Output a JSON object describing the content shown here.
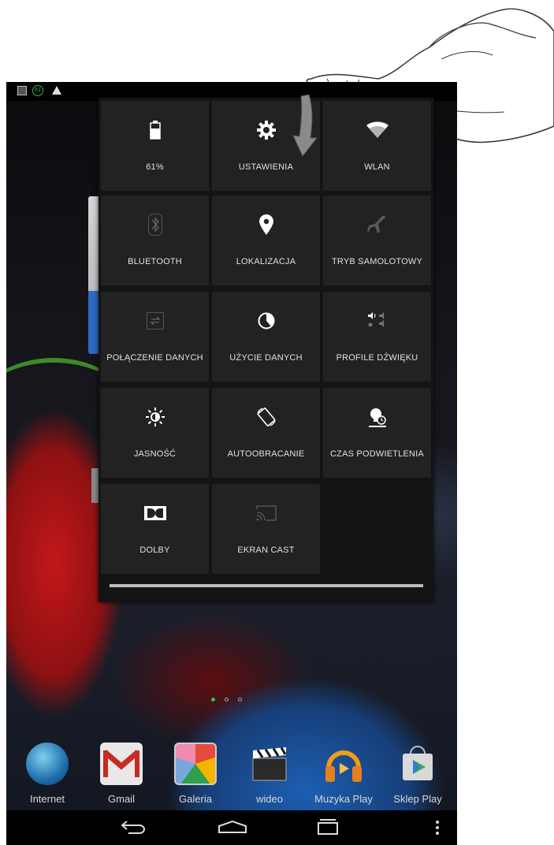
{
  "status_bar": {
    "battery_level": "61",
    "icons": [
      "image-icon",
      "battery-icon",
      "warning-icon"
    ]
  },
  "quick_settings": {
    "tiles": [
      {
        "label": "61%",
        "icon": "battery-icon",
        "state": "on"
      },
      {
        "label": "USTAWIENIA",
        "icon": "gear-icon",
        "state": "on"
      },
      {
        "label": "WLAN",
        "icon": "wifi-icon",
        "state": "on"
      },
      {
        "label": "BLUETOOTH",
        "icon": "bluetooth-icon",
        "state": "off"
      },
      {
        "label": "LOKALIZACJA",
        "icon": "location-pin-icon",
        "state": "on"
      },
      {
        "label": "TRYB SAMOLOTOWY",
        "icon": "airplane-icon",
        "state": "off"
      },
      {
        "label": "POŁĄCZENIE DANYCH",
        "icon": "data-connection-icon",
        "state": "off"
      },
      {
        "label": "UŻYCIE DANYCH",
        "icon": "data-usage-icon",
        "state": "on"
      },
      {
        "label": "PROFILE DŹWIĘKU",
        "icon": "sound-profiles-icon",
        "state": "on"
      },
      {
        "label": "JASNOŚĆ",
        "icon": "brightness-icon",
        "state": "on"
      },
      {
        "label": "AUTOOBRACANIE",
        "icon": "auto-rotate-icon",
        "state": "on"
      },
      {
        "label": "CZAS PODWIETLENIA",
        "icon": "screen-timeout-icon",
        "state": "on"
      },
      {
        "label": "DOLBY",
        "icon": "dolby-icon",
        "state": "on"
      },
      {
        "label": "EKRAN CAST",
        "icon": "cast-screen-icon",
        "state": "off"
      }
    ]
  },
  "home": {
    "page_count": 3,
    "current_page": 1
  },
  "dock": {
    "apps": [
      {
        "label": "Internet",
        "icon": "globe-icon"
      },
      {
        "label": "Gmail",
        "icon": "gmail-icon"
      },
      {
        "label": "Galeria",
        "icon": "gallery-icon"
      },
      {
        "label": "wideo",
        "icon": "video-clapper-icon"
      },
      {
        "label": "Muzyka Play",
        "icon": "headphones-icon"
      },
      {
        "label": "Sklep Play",
        "icon": "play-store-icon"
      }
    ]
  },
  "nav_bar": {
    "buttons": [
      "back-icon",
      "home-icon",
      "recents-icon",
      "menu-icon"
    ]
  },
  "colors": {
    "accent_green": "#3fb34f",
    "tile_bg": "#222222",
    "panel_bg": "#141414"
  }
}
